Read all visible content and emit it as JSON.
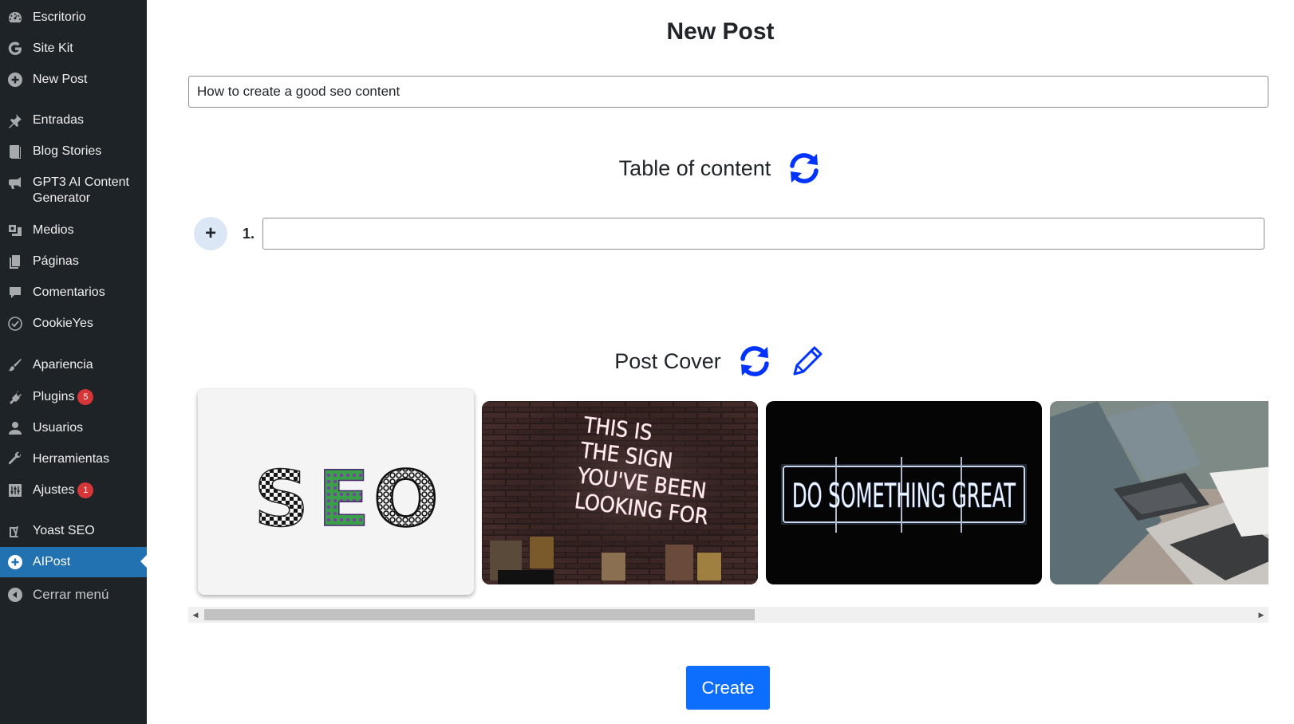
{
  "sidebar": {
    "items": [
      {
        "label": "Escritorio",
        "icon": "dashboard-icon"
      },
      {
        "label": "Site Kit",
        "icon": "google-g-icon"
      },
      {
        "label": "New Post",
        "icon": "plus-circle-icon"
      },
      {
        "label": "Entradas",
        "icon": "pin-icon"
      },
      {
        "label": "Blog Stories",
        "icon": "book-icon"
      },
      {
        "label": "GPT3 AI Content Generator",
        "icon": "megaphone-icon"
      },
      {
        "label": "Medios",
        "icon": "media-icon"
      },
      {
        "label": "Páginas",
        "icon": "page-icon"
      },
      {
        "label": "Comentarios",
        "icon": "comment-icon"
      },
      {
        "label": "CookieYes",
        "icon": "cookie-icon"
      },
      {
        "label": "Apariencia",
        "icon": "brush-icon"
      },
      {
        "label": "Plugins",
        "icon": "plugin-icon",
        "badge": "5"
      },
      {
        "label": "Usuarios",
        "icon": "user-icon"
      },
      {
        "label": "Herramientas",
        "icon": "wrench-icon"
      },
      {
        "label": "Ajustes",
        "icon": "settings-icon",
        "badge": "1"
      },
      {
        "label": "Yoast SEO",
        "icon": "yoast-icon"
      },
      {
        "label": "AIPost",
        "icon": "plus-circle-icon",
        "active": true
      },
      {
        "label": "Cerrar menú",
        "icon": "collapse-icon"
      }
    ]
  },
  "main": {
    "page_title": "New Post",
    "title_input_value": "How to create a good seo content",
    "toc_heading": "Table of content",
    "toc_add_label": "+",
    "toc_item_number": "1.",
    "toc_item_value": "",
    "cover_heading": "Post Cover",
    "create_label": "Create"
  },
  "covers": [
    {
      "name": "seo-letters",
      "text": "SEO",
      "selected": true
    },
    {
      "name": "neon-sign",
      "text": "THIS IS THE SIGN YOU'VE BEEN LOOKING FOR"
    },
    {
      "name": "neon-great",
      "text": "DO SOMETHING GREAT"
    },
    {
      "name": "laptop-desk"
    }
  ],
  "colors": {
    "sidebar_bg": "#1d2327",
    "active_bg": "#2271b1",
    "accent_blue": "#0033ff",
    "create_button": "#0d6efd",
    "badge": "#d63638"
  }
}
